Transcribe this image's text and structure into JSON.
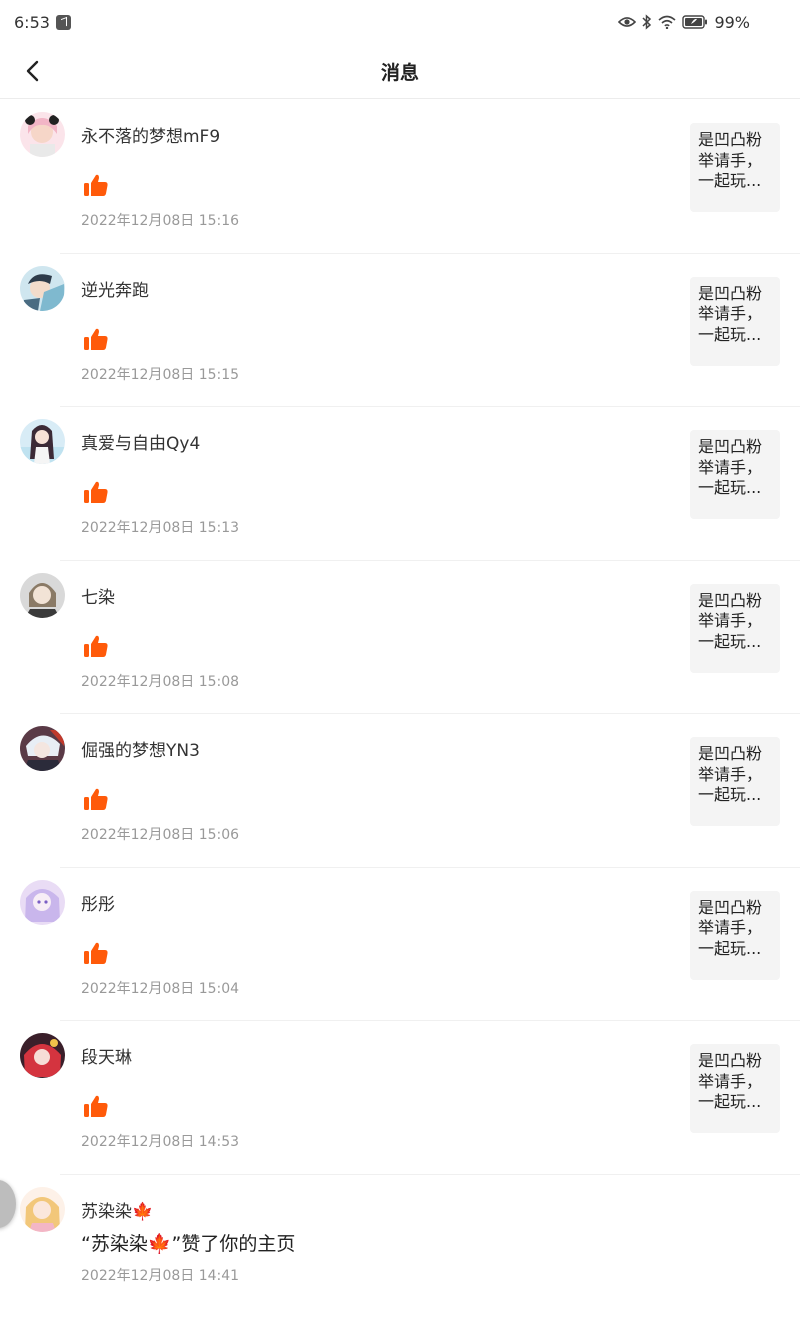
{
  "status_bar": {
    "time": "6:53",
    "battery": "99%",
    "icons": [
      "app-notification-icon",
      "eye-icon",
      "bluetooth-icon",
      "wifi-icon",
      "battery-icon"
    ]
  },
  "header": {
    "title": "消息",
    "back_icon": "chevron-left-icon"
  },
  "colors": {
    "like": "#ff5a0a",
    "time": "#999999",
    "preview_bg": "#f4f4f4"
  },
  "notifications": [
    {
      "username": "永不落的梦想mF9",
      "time": "2022年12月08日 15:16",
      "preview": [
        "是凹凸粉",
        "举请手，",
        "一起玩..."
      ]
    },
    {
      "username": "逆光奔跑",
      "time": "2022年12月08日 15:15",
      "preview": [
        "是凹凸粉",
        "举请手，",
        "一起玩..."
      ]
    },
    {
      "username": "真爱与自由Qy4",
      "time": "2022年12月08日 15:13",
      "preview": [
        "是凹凸粉",
        "举请手，",
        "一起玩..."
      ]
    },
    {
      "username": "七染",
      "time": "2022年12月08日 15:08",
      "preview": [
        "是凹凸粉",
        "举请手，",
        "一起玩..."
      ]
    },
    {
      "username": "倔强的梦想YN3",
      "time": "2022年12月08日 15:06",
      "preview": [
        "是凹凸粉",
        "举请手，",
        "一起玩..."
      ]
    },
    {
      "username": "彤彤",
      "time": "2022年12月08日 15:04",
      "preview": [
        "是凹凸粉",
        "举请手，",
        "一起玩..."
      ]
    },
    {
      "username": "段天琳",
      "time": "2022年12月08日 14:53",
      "preview": [
        "是凹凸粉",
        "举请手，",
        "一起玩..."
      ]
    },
    {
      "username": "苏染染🍁",
      "message": "“苏染染🍁”赞了你的主页",
      "time": "2022年12月08日 14:41"
    }
  ]
}
